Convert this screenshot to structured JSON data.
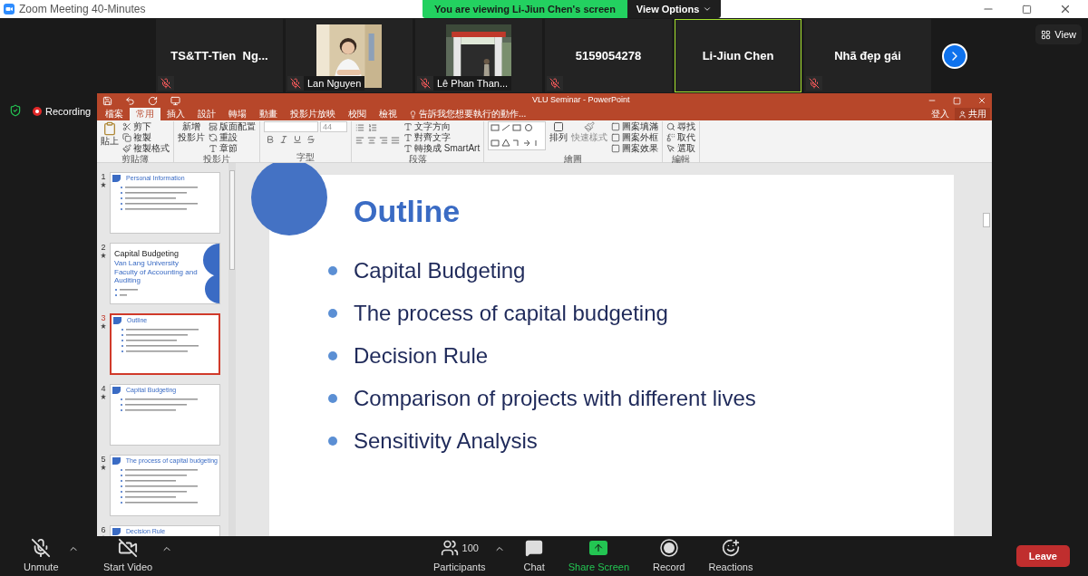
{
  "window": {
    "title": "Zoom Meeting 40-Minutes"
  },
  "banner": {
    "text": "You are viewing Li-Jiun Chen's screen",
    "view_options": "View Options"
  },
  "view_button": "View",
  "recording": "Recording",
  "participants": [
    {
      "name": "TS&TT-Tien  Ng...",
      "kind": "name",
      "muted": true,
      "speaking": false
    },
    {
      "name": "Lan Nguyen",
      "kind": "video",
      "muted": true,
      "speaking": false
    },
    {
      "name": "Lê Phan Than...",
      "kind": "video",
      "muted": true,
      "speaking": false
    },
    {
      "name": "5159054278",
      "kind": "name",
      "muted": true,
      "speaking": false
    },
    {
      "name": "Li-Jiun Chen",
      "kind": "name",
      "muted": false,
      "speaking": true
    },
    {
      "name": "Nhã đẹp gái",
      "kind": "name",
      "muted": true,
      "speaking": false
    }
  ],
  "powerpoint": {
    "title": "VLU Seminar - PowerPoint",
    "sign_in": "登入",
    "share": "共用",
    "tell_me": "告訴我您想要執行的動作...",
    "tabs": [
      {
        "label": "檔案",
        "selected": false
      },
      {
        "label": "常用",
        "selected": true
      },
      {
        "label": "插入",
        "selected": false
      },
      {
        "label": "設計",
        "selected": false
      },
      {
        "label": "轉場",
        "selected": false
      },
      {
        "label": "動畫",
        "selected": false
      },
      {
        "label": "投影片放映",
        "selected": false
      },
      {
        "label": "校閱",
        "selected": false
      },
      {
        "label": "檢視",
        "selected": false
      }
    ],
    "ribbon": {
      "clipboard": {
        "label": "剪貼簿",
        "paste": "貼上",
        "items": [
          "剪下",
          "複製",
          "複製格式"
        ]
      },
      "slides": {
        "label": "投影片",
        "new_slide": [
          "新增",
          "投影片"
        ],
        "items": [
          "版面配置",
          "重設",
          "章節"
        ]
      },
      "font": {
        "label": "字型",
        "size": "44"
      },
      "paragraph": {
        "label": "段落",
        "items": [
          "文字方向",
          "對齊文字",
          "轉換成 SmartArt"
        ]
      },
      "drawing": {
        "label": "繪圖",
        "arrange": "排列",
        "quick_styles": "快速樣式",
        "items": [
          "圖案填滿",
          "圖案外框",
          "圖案效果"
        ]
      },
      "editing": {
        "label": "編輯",
        "items": [
          "尋找",
          "取代",
          "選取"
        ]
      }
    },
    "thumbnails": [
      {
        "number": "1",
        "kind": "content",
        "title": "Personal Information",
        "selected": false
      },
      {
        "number": "2",
        "kind": "title",
        "title": "Capital Budgeting",
        "subtitle": [
          "Van Lang University",
          "Faculty of Accounting and Auditing"
        ],
        "selected": false
      },
      {
        "number": "3",
        "kind": "content",
        "title": "Outline",
        "selected": true
      },
      {
        "number": "4",
        "kind": "content",
        "title": "Capital Budgeting",
        "selected": false
      },
      {
        "number": "5",
        "kind": "content",
        "title": "The process of capital budgeting",
        "selected": false
      },
      {
        "number": "6",
        "kind": "content",
        "title": "Decision Rule",
        "selected": false
      }
    ],
    "slide": {
      "title": "Outline",
      "bullets": [
        "Capital Budgeting",
        "The process of capital budgeting",
        "Decision Rule",
        "Comparison of projects with different lives",
        "Sensitivity Analysis"
      ]
    }
  },
  "toolbar": {
    "items": [
      {
        "kind": "mic",
        "label": "Unmute",
        "caret": true
      },
      {
        "kind": "video",
        "label": "Start Video",
        "caret": true
      },
      {
        "kind": "participants",
        "label": "Participants",
        "count": "100",
        "caret": true
      },
      {
        "kind": "chat",
        "label": "Chat",
        "caret": false
      },
      {
        "kind": "share",
        "label": "Share Screen",
        "caret": false
      },
      {
        "kind": "record",
        "label": "Record",
        "caret": false
      },
      {
        "kind": "reactions",
        "label": "Reactions",
        "caret": false
      }
    ],
    "leave": "Leave"
  }
}
